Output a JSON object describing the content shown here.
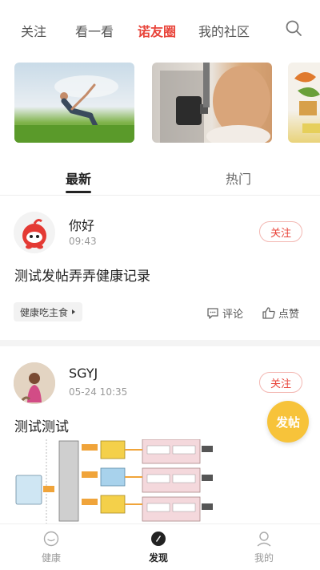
{
  "top_tabs": [
    {
      "label": "关注"
    },
    {
      "label": "看一看"
    },
    {
      "label": "诺友圈"
    },
    {
      "label": "我的社区"
    }
  ],
  "active_top_tab": "诺友圈",
  "sub_tabs": [
    {
      "label": "最新"
    },
    {
      "label": "热门"
    }
  ],
  "posts": [
    {
      "user": "你好",
      "time": "09:43",
      "follow_label": "关注",
      "text": "测试发帖弄弄健康记录",
      "tag": "健康吃主食",
      "comment_label": "评论",
      "like_label": "点赞"
    },
    {
      "user": "SGYJ",
      "time": "05-24 10:35",
      "follow_label": "关注",
      "text": "测试测试"
    }
  ],
  "fab_label": "发帖",
  "bottom_nav": [
    {
      "label": "健康"
    },
    {
      "label": "发现"
    },
    {
      "label": "我的"
    }
  ],
  "colors": {
    "accent": "#e8443a",
    "fab": "#f7c33a"
  }
}
